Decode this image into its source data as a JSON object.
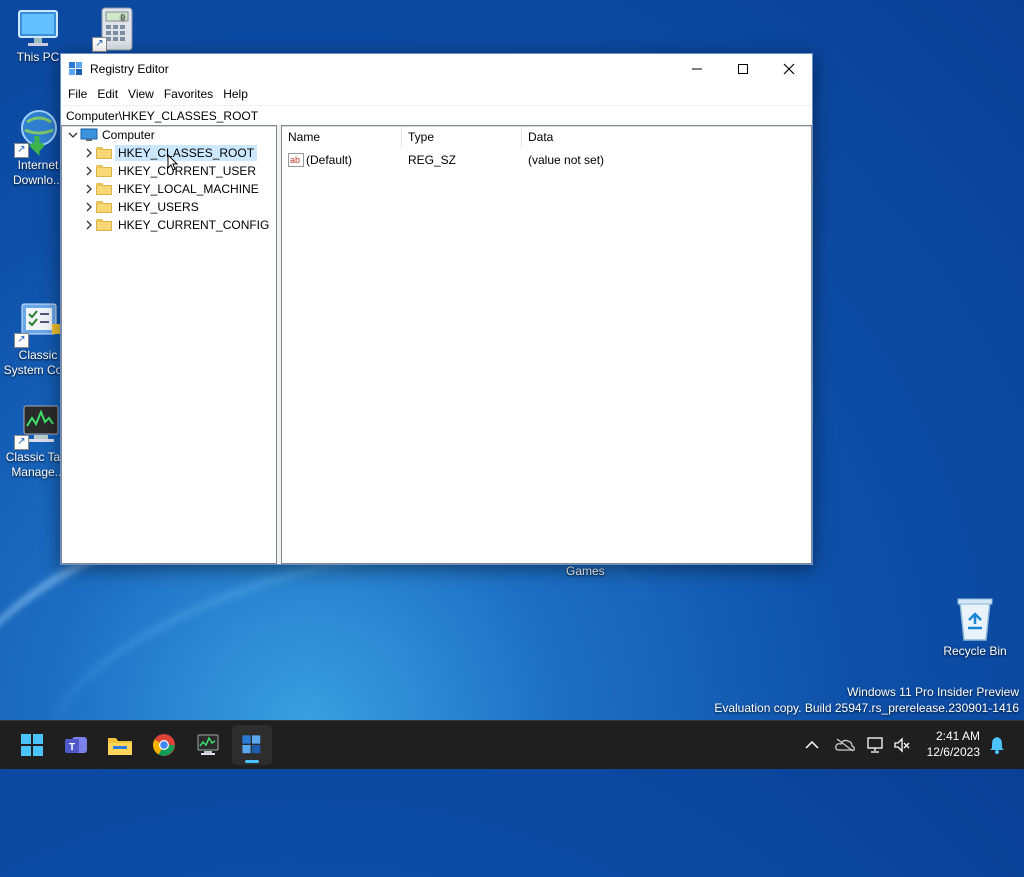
{
  "desktop": {
    "icons": [
      {
        "label": "This PC",
        "icon": "monitor-icon"
      },
      {
        "label": "",
        "icon": "calculator-icon"
      },
      {
        "label": "Internet Downlo...",
        "icon": "internet-download-icon"
      },
      {
        "label": "Classic System Co...",
        "icon": "control-panel-icon"
      },
      {
        "label": "Classic Ta... Manage...",
        "icon": "task-manager-icon"
      },
      {
        "label": "Recycle Bin",
        "icon": "recycle-bin-icon"
      }
    ],
    "games_label": "Games",
    "watermark_line1": "Windows 11 Pro Insider Preview",
    "watermark_line2": "Evaluation copy. Build 25947.rs_prerelease.230901-1416"
  },
  "window": {
    "title": "Registry Editor",
    "menu": [
      "File",
      "Edit",
      "View",
      "Favorites",
      "Help"
    ],
    "address": "Computer\\HKEY_CLASSES_ROOT",
    "tree": {
      "root": "Computer",
      "keys": [
        "HKEY_CLASSES_ROOT",
        "HKEY_CURRENT_USER",
        "HKEY_LOCAL_MACHINE",
        "HKEY_USERS",
        "HKEY_CURRENT_CONFIG"
      ],
      "selected": "HKEY_CLASSES_ROOT"
    },
    "list": {
      "columns": [
        "Name",
        "Type",
        "Data"
      ],
      "rows": [
        {
          "name": "(Default)",
          "type": "REG_SZ",
          "data": "(value not set)"
        }
      ]
    }
  },
  "taskbar": {
    "apps": [
      "start-icon",
      "teams-icon",
      "file-explorer-icon",
      "chrome-icon",
      "task-manager-icon",
      "registry-editor-icon"
    ],
    "active_app": "registry-editor-icon",
    "time": "2:41 AM",
    "date": "12/6/2023"
  },
  "colors": {
    "selection": "#cce8ff",
    "taskbar": "#1f1f1f",
    "accent": "#4cc2ff"
  }
}
